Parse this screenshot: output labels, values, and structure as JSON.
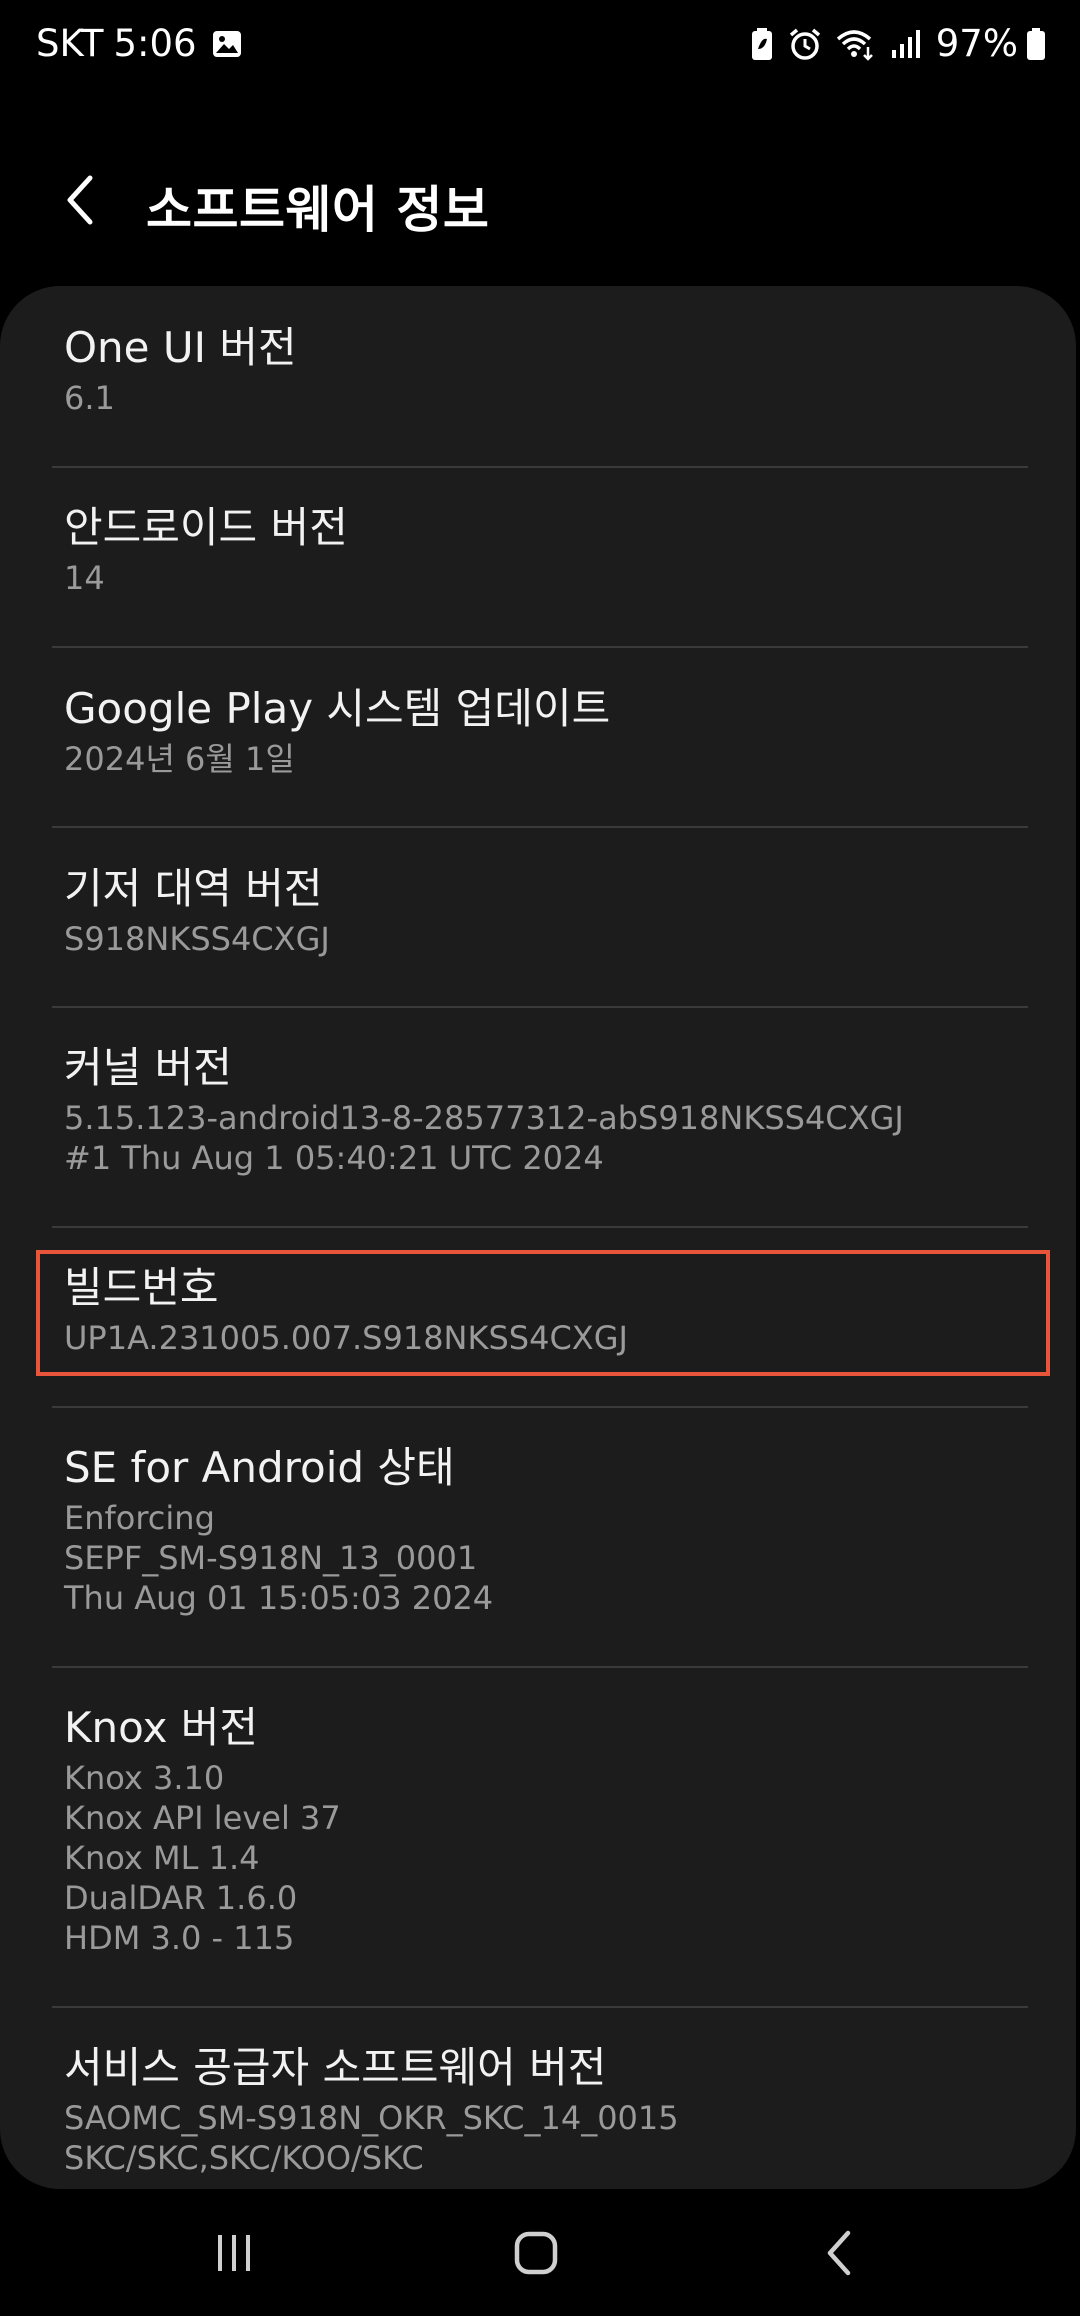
{
  "status_bar": {
    "carrier": "SKT",
    "time": "5:06",
    "battery_percent": "97%",
    "icons": [
      "gallery-icon",
      "battery-saver-icon",
      "alarm-icon",
      "wifi-icon",
      "signal-icon",
      "battery-icon"
    ]
  },
  "header": {
    "title": "소프트웨어 정보",
    "back_icon": "chevron-left-icon"
  },
  "items": [
    {
      "title": "One UI 버전",
      "lines": [
        "6.1"
      ]
    },
    {
      "title": "안드로이드 버전",
      "lines": [
        "14"
      ]
    },
    {
      "title": "Google Play 시스템 업데이트",
      "lines": [
        "2024년 6월 1일"
      ]
    },
    {
      "title": "기저 대역 버전",
      "lines": [
        "S918NKSS4CXGJ"
      ]
    },
    {
      "title": "커널 버전",
      "lines": [
        "5.15.123-android13-8-28577312-abS918NKSS4CXGJ",
        "#1 Thu Aug 1 05:40:21 UTC 2024"
      ]
    },
    {
      "title": "빌드번호",
      "lines": [
        "UP1A.231005.007.S918NKSS4CXGJ"
      ]
    },
    {
      "title": "SE for Android 상태",
      "lines": [
        "Enforcing",
        "SEPF_SM-S918N_13_0001",
        "Thu Aug 01 15:05:03 2024"
      ]
    },
    {
      "title": "Knox 버전",
      "lines": [
        "Knox 3.10",
        "Knox API level 37",
        "Knox ML 1.4",
        "DualDAR 1.6.0",
        "HDM 3.0 - 115"
      ]
    },
    {
      "title": "서비스 공급자 소프트웨어 버전",
      "lines": [
        "SAOMC_SM-S918N_OKR_SKC_14_0015",
        "SKC/SKC,SKC/KOO/SKC"
      ]
    }
  ],
  "highlight_color": "#e8553a",
  "nav_bar": {
    "icons": [
      "recent-apps-icon",
      "home-icon",
      "back-icon"
    ]
  }
}
